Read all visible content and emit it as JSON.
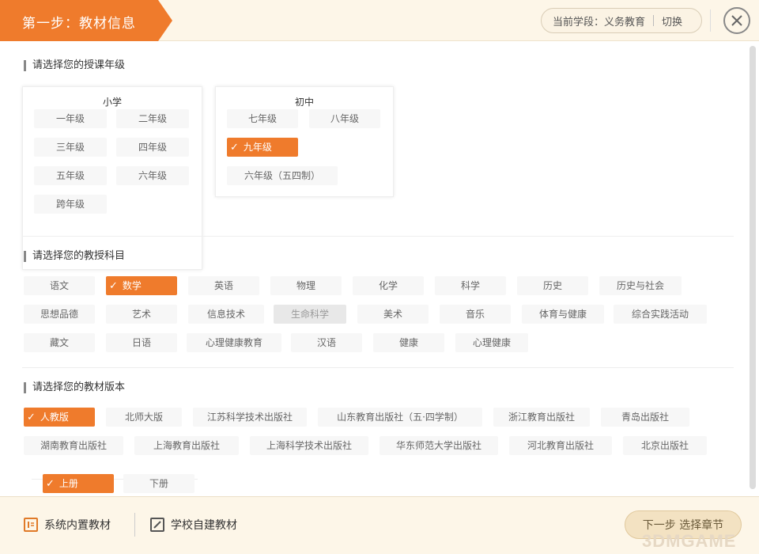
{
  "header": {
    "step_title": "第一步：教材信息",
    "stage_label": "当前学段：义务教育",
    "switch_label": "切换",
    "close_label": "✕"
  },
  "grade_section": {
    "title": "请选择您的授课年级",
    "primary": {
      "title": "小学",
      "items": [
        "一年级",
        "二年级",
        "三年级",
        "四年级",
        "五年级",
        "六年级",
        "跨年级"
      ]
    },
    "junior": {
      "title": "初中",
      "items": [
        "七年级",
        "八年级",
        "九年级",
        "六年级（五四制）"
      ],
      "selected": "九年级"
    }
  },
  "subject_section": {
    "title": "请选择您的教授科目",
    "items": [
      "语文",
      "数学",
      "英语",
      "物理",
      "化学",
      "科学",
      "历史",
      "历史与社会",
      "思想品德",
      "艺术",
      "信息技术",
      "生命科学",
      "美术",
      "音乐",
      "体育与健康",
      "综合实践活动",
      "藏文",
      "日语",
      "心理健康教育",
      "汉语",
      "健康",
      "心理健康"
    ],
    "selected": "数学",
    "disabled": "生命科学"
  },
  "edition_section": {
    "title": "请选择您的教材版本",
    "items": [
      "人教版",
      "北师大版",
      "江苏科学技术出版社",
      "山东教育出版社（五·四学制）",
      "浙江教育出版社",
      "青岛出版社",
      "湖南教育出版社",
      "上海教育出版社",
      "上海科学技术出版社",
      "华东师范大学出版社",
      "河北教育出版社",
      "北京出版社"
    ],
    "selected": "人教版"
  },
  "volume": {
    "items": [
      "上册",
      "下册"
    ],
    "selected": "上册"
  },
  "footer": {
    "builtin_label": "系统内置教材",
    "custom_label": "学校自建教材",
    "next_label": "下一步 选择章节",
    "watermark": "3DMGAME"
  },
  "colors": {
    "accent": "#ef7b2c",
    "header_bg": "#fdf6e8"
  },
  "icons": {
    "check": "✓",
    "builtin": "book-icon",
    "custom": "edit-icon",
    "close": "close-icon"
  }
}
